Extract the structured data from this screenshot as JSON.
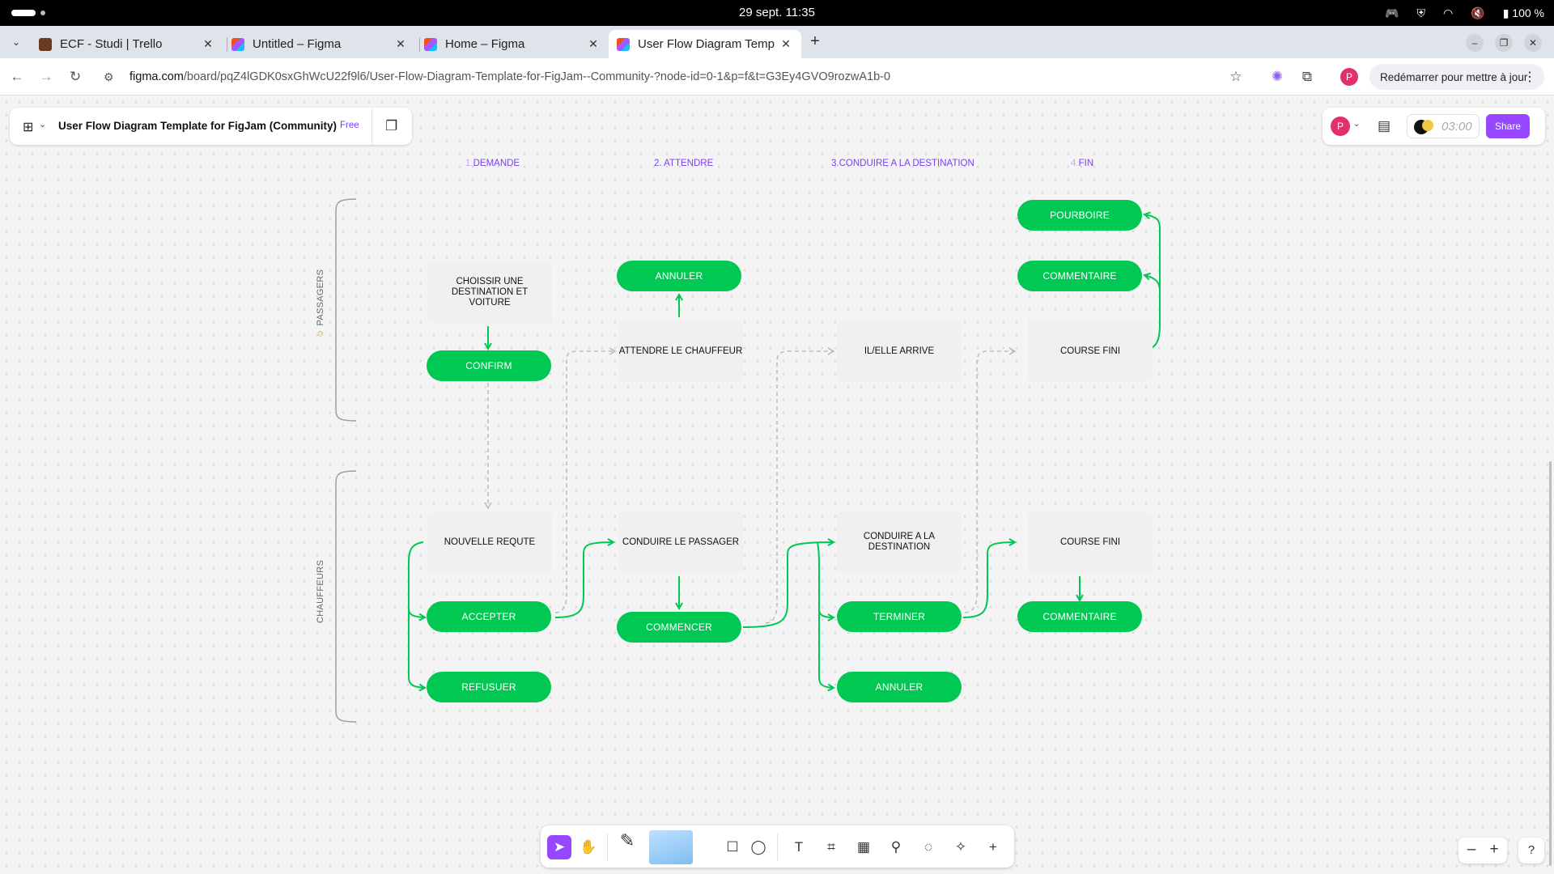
{
  "os": {
    "clock": "29 sept.  11:35",
    "battery": "100 %"
  },
  "tabs": [
    {
      "title": "ECF - Studi | Trello",
      "color": "#6b3a1f"
    },
    {
      "title": "Untitled – Figma",
      "color": "#f24e1e"
    },
    {
      "title": "Home – Figma",
      "color": "#f24e1e"
    },
    {
      "title": "User Flow Diagram Temp",
      "color": "#f24e1e"
    }
  ],
  "address": {
    "host": "figma.com",
    "path": "/board/pqZ4lGDK0sxGhWcU22f9l6/User-Flow-Diagram-Template-for-FigJam--Community-?node-id=0-1&p=f&t=G3Ey4GVO9rozwA1b-0",
    "restart_label": "Redémarrer pour mettre à jour",
    "profile_initial": "P"
  },
  "file": {
    "name": "User Flow Diagram Template for FigJam (Community)",
    "plan": "Free"
  },
  "toolbar_right": {
    "avatar": "P",
    "timer": "03:00",
    "share": "Share"
  },
  "columns": [
    {
      "num": "1.",
      "label": "DEMANDE"
    },
    {
      "num": "2. ",
      "label": "ATTENDRE"
    },
    {
      "num": "3.",
      "label": "CONDUIRE A LA DESTINATION"
    },
    {
      "num": "4.",
      "label": "FIN"
    }
  ],
  "lanes": {
    "passengers": "PASSAGERS",
    "drivers": "CHAUFFEURS"
  },
  "notes": {
    "choose": "CHOISSIR UNE DESTINATION ET VOITURE",
    "wait_driver": "ATTENDRE LE CHAUFFEUR",
    "arrives": "IL/ELLE ARRIVE",
    "ride_done_p": "COURSE FINI",
    "new_request": "NOUVELLE REQUTE",
    "drive_passenger": "CONDUIRE LE PASSAGER",
    "drive_destination": "CONDUIRE A LA DESTINATION",
    "ride_done_d": "COURSE FINI"
  },
  "actions": {
    "confirm": "CONFIRM",
    "cancel_p": "ANNULER",
    "tip": "POURBOIRE",
    "comment_p": "COMMENTAIRE",
    "accept": "ACCEPTER",
    "refuse": "REFUSUER",
    "start": "COMMENCER",
    "finish": "TERMINER",
    "cancel_d": "ANNULER",
    "comment_d": "COMMENTAIRE"
  }
}
